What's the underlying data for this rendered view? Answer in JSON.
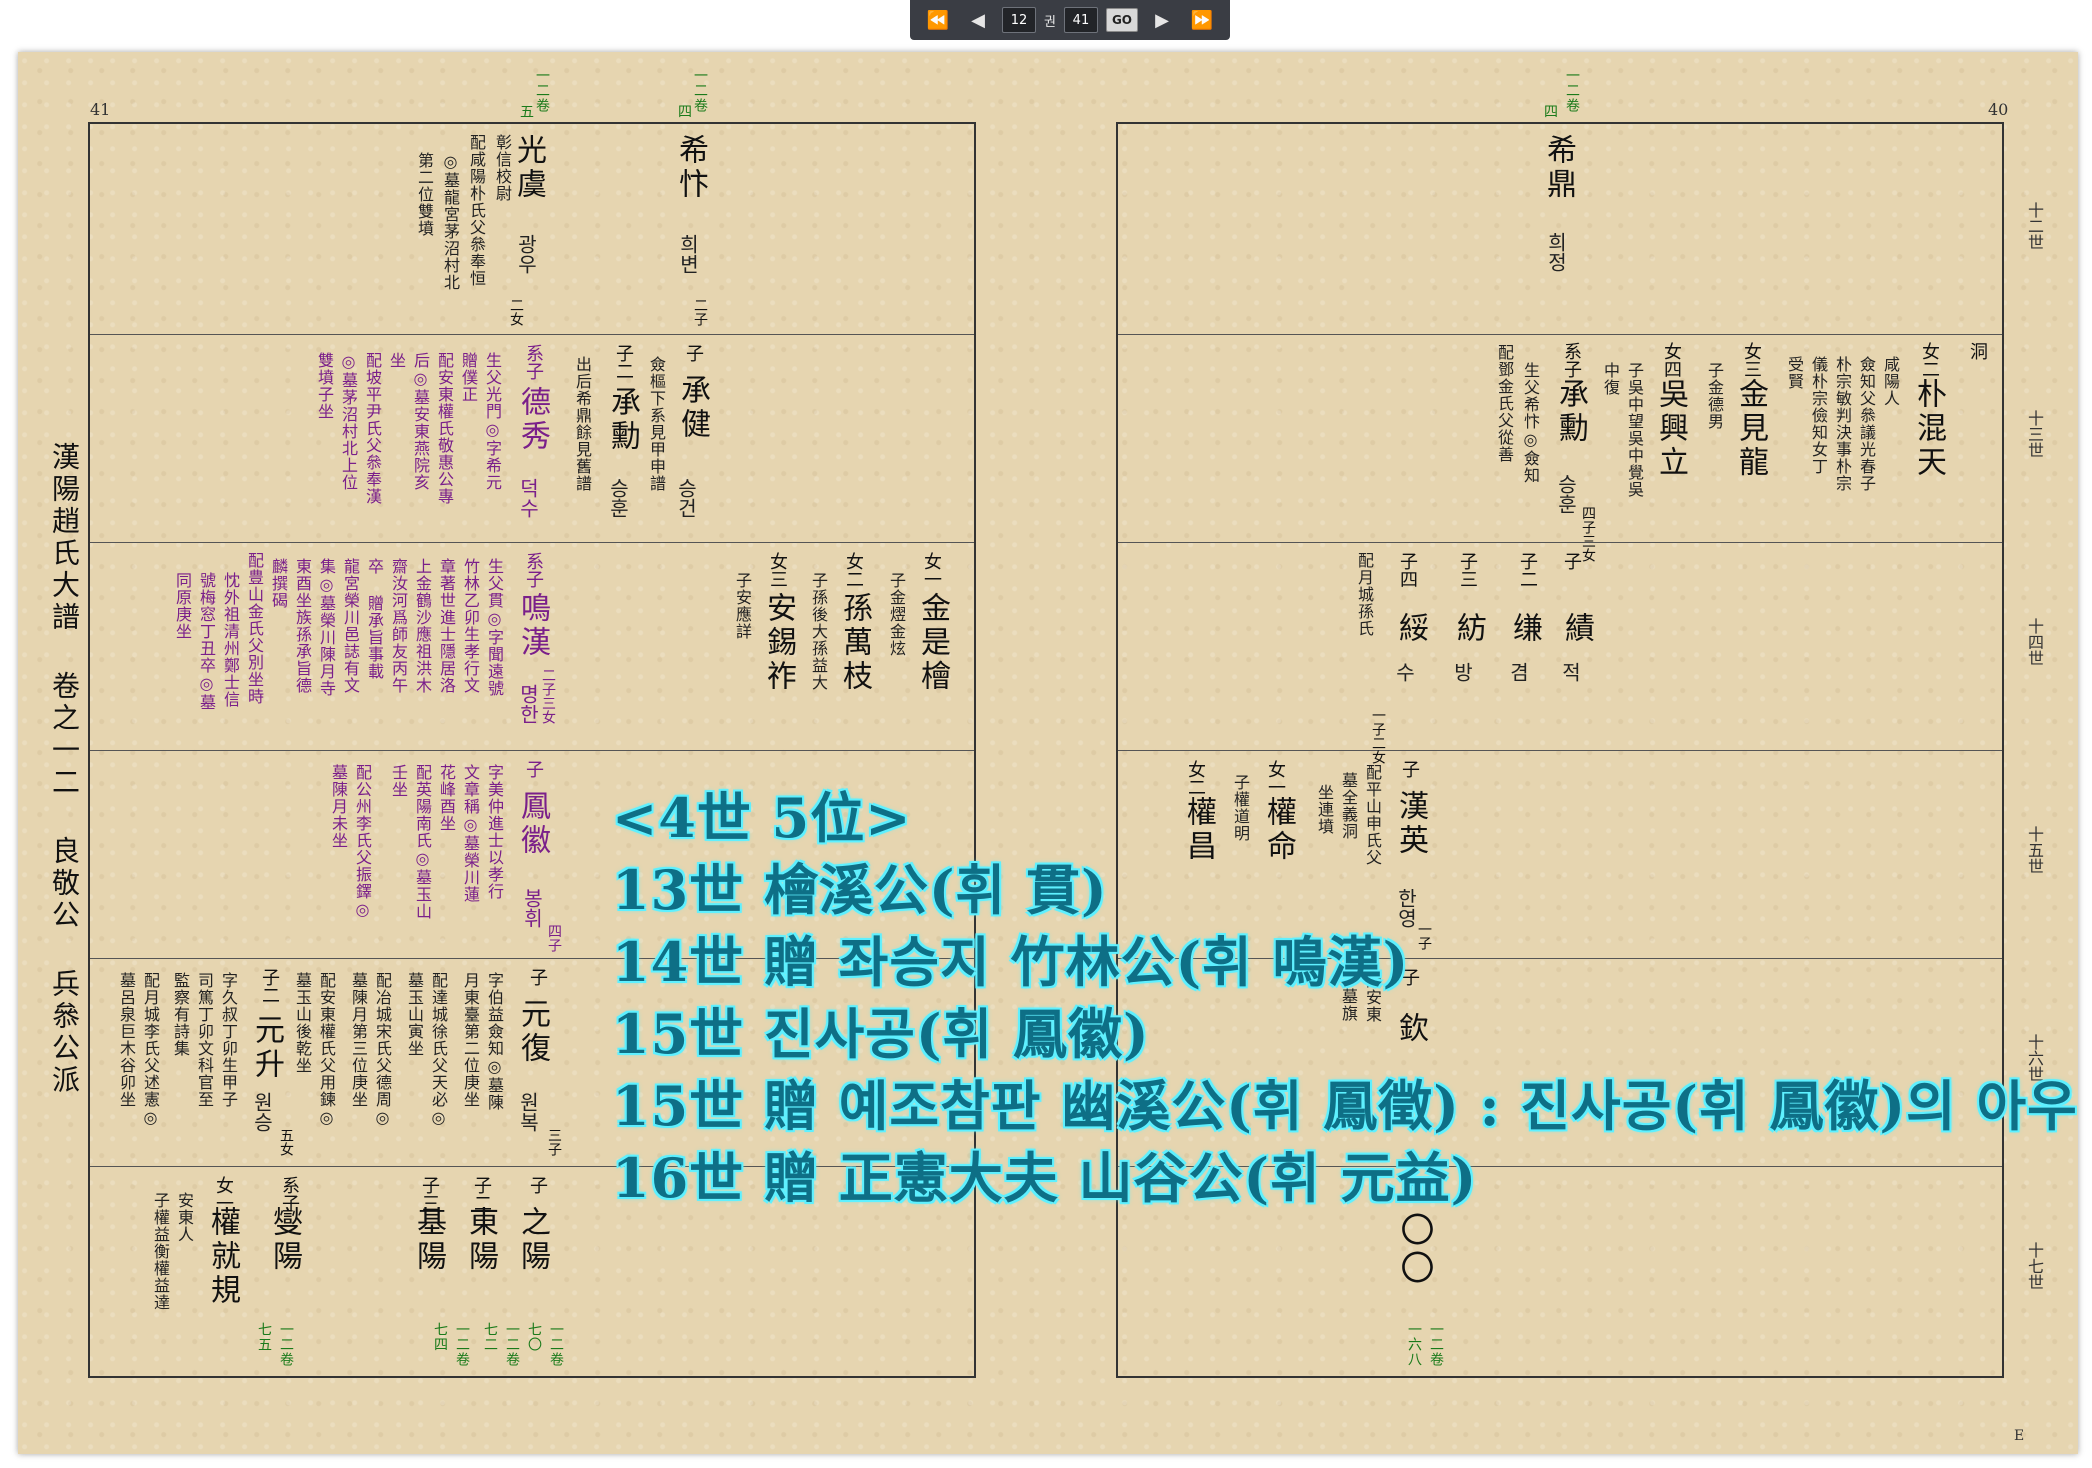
{
  "toolbar": {
    "first_icon": "⏪",
    "prev_icon": "◀",
    "next_icon": "▶",
    "last_icon": "⏩",
    "volume_value": "12",
    "volume_unit": "권",
    "page_value": "41",
    "go_label": "GO"
  },
  "book": {
    "title": "漢陽趙氏大譜 卷之一二 良敬公 兵叅公派",
    "left_page_number": "41",
    "right_page_number": "40",
    "corner_mark": "Ε"
  },
  "generations": [
    "十二世",
    "十三世",
    "十四世",
    "十五世",
    "十六世",
    "十七世"
  ],
  "left_page": {
    "top_tags": [
      {
        "vol": "一二卷",
        "sub": "五"
      },
      {
        "vol": "一二卷",
        "sub": "四"
      }
    ],
    "r1": {
      "a_name": "希忭",
      "a_hangul": "희변",
      "a_count": "二子",
      "b_name": "光虞",
      "b_hangul": "광우",
      "b_count": "二女",
      "b_note": [
        "彰信校尉",
        "配咸陽朴氏父叅奉恒",
        "◎墓龍宮茅沼村北",
        "第二位雙墳"
      ]
    },
    "r2": {
      "c1_rel": "子",
      "c1_name": "承健",
      "c1_hangul": "승건",
      "c1_note": [
        "僉樞下系見甲申譜"
      ],
      "c2_rel": "子二",
      "c2_name": "承勳",
      "c2_hangul": "승훈",
      "c2_note": [
        "出后希鼎餘見舊譜"
      ],
      "c3_rel": "系子",
      "c3_name": "德秀",
      "c3_hangul": "덕수",
      "c3_note": [
        "生父光門◎字希元",
        "贈僕正",
        "配安東權氏敬惠公專",
        "后◎墓安東燕院亥",
        "坐",
        "配坡平尹氏父叅奉漢",
        "◎墓茅沼村北上位",
        "雙墳子坐"
      ]
    },
    "r3": {
      "d1_rel": "女一",
      "d1_name": "金是檜",
      "d1_note": [
        "子金熤金炫"
      ],
      "d2_rel": "女二",
      "d2_name": "孫萬枝",
      "d2_note": [
        "子孫後大孫益大"
      ],
      "d3_rel": "女三",
      "d3_name": "安錫祚",
      "d3_note": [
        "子安應詳"
      ],
      "d4_rel": "系子",
      "d4_name": "鳴漢",
      "d4_hangul": "명한",
      "d4_count": "二子三女",
      "d4_note": [
        "生父貫◎字聞遠號",
        "竹林乙卯生孝行文",
        "章著世進士隱居洛",
        "上金鶴沙應祖洪木",
        "齋汝河爲師友丙午",
        "卒 贈承旨事載",
        "龍宮榮川邑誌有文",
        "集◎墓榮川陳月寺",
        "東酉坐族孫承旨德",
        "麟撰碣",
        "配豊山金氏父別坐時",
        "忱外祖清州鄭士信",
        "號梅窓丁丑卒◎墓",
        "同原庚坐"
      ]
    },
    "r4": {
      "e1_rel": "子",
      "e1_name": "鳳徽",
      "e1_hangul": "봉휘",
      "e1_count": "四子",
      "e1_note": [
        "字美仲進士以孝行",
        "文章稱◎墓榮川蓮",
        "花峰酉坐",
        "配英陽南氏◎墓玉山",
        "壬坐",
        "配公州李氏父振鐸◎",
        "墓陳月未坐"
      ]
    },
    "r5": {
      "f1_rel": "子",
      "f1_name": "元復",
      "f1_hangul": "원복",
      "f1_count": "三子",
      "f1_note": [
        "字伯益僉知◎墓陳",
        "月東臺第二位庚坐",
        "配達城徐氏父天必◎",
        "墓玉山寅坐",
        "配冶城宋氏父德周◎",
        "墓陳月第三位庚坐",
        "配安東權氏父用鍊◎",
        "墓玉山後乾坐"
      ],
      "f2_rel": "子二",
      "f2_name": "元升",
      "f2_hangul": "원승",
      "f2_count": "五女",
      "f2_note": [
        "字久叔丁卯生甲子",
        "司篤丁卯文科官至",
        "監察有詩集",
        "配月城李氏父述憲◎",
        "墓呂泉巨木谷卯坐"
      ]
    },
    "r6": {
      "g1_rel": "子",
      "g1_name": "之陽",
      "g2_rel": "子二",
      "g2_name": "東陽",
      "g3_rel": "子三",
      "g3_name": "基陽",
      "g4_rel": "系子",
      "g4_name": "燮陽",
      "g5_rel": "女一",
      "g5_name": "權就規",
      "g5_note": [
        "安東人",
        "子權益衡權益達"
      ]
    },
    "bottom_tags": [
      {
        "vol": "一二卷",
        "sub": "七〇"
      },
      {
        "vol": "一二卷",
        "sub": "七二"
      },
      {
        "vol": "一二卷",
        "sub": "七四"
      },
      {
        "vol": "一二卷",
        "sub": "七五"
      }
    ]
  },
  "right_page": {
    "top_tag": {
      "vol": "一二卷",
      "sub": "四"
    },
    "r1": {
      "name": "希鼎",
      "hangul": "희정"
    },
    "r2": {
      "h1_rel": "女二",
      "h1_name": "朴混天",
      "h1_note": [
        "咸陽人",
        "僉知父叅議光春子",
        "朴宗敏判決事朴宗",
        "儀朴宗儉知女丁",
        "受賢"
      ],
      "h2_rel": "女三",
      "h2_name": "金見龍",
      "h2_note": [
        "子金德男"
      ],
      "h3_rel": "女四",
      "h3_name": "吳興立",
      "h3_note": [
        "子吳中望吳中覺吳",
        "中復"
      ],
      "h4_rel": "系子",
      "h4_name": "承勳",
      "h4_hangul": "승훈",
      "h4_count": "四子三女",
      "h4_note": [
        "生父希忭◎僉知",
        "配鄧金氏父從善"
      ],
      "h5_word": "洞"
    },
    "r3": {
      "i1_rel": "子",
      "i1_name": "績",
      "i1_hangul": "적",
      "i2_rel": "子二",
      "i2_name": "缣",
      "i2_hangul": "겸",
      "i3_rel": "子三",
      "i3_name": "紡",
      "i3_hangul": "방",
      "i4_rel": "子四",
      "i4_name": "綏",
      "i4_hangul": "수",
      "i5_note": [
        "配月城孫氏"
      ],
      "i6_count": "一子二女"
    },
    "r4": {
      "j1_rel": "子",
      "j1_name": "漢英",
      "j1_hangul": "한영",
      "j1_count": "一子",
      "j1_note": [
        "配平山申氏父",
        "墓全義洞",
        "坐連墳"
      ],
      "j2_rel": "女一",
      "j2_name": "權命",
      "j2_note": [
        "子權道明"
      ],
      "j3_rel": "女二",
      "j3_name": "權昌"
    },
    "r5": {
      "k1_rel": "子",
      "k1_name": "欽",
      "k1_note": [
        "配安東",
        "墓旗"
      ]
    },
    "r6": {
      "l1_rel": "子",
      "l1_name": "〇〇"
    },
    "bottom_tag": {
      "vol": "一二卷",
      "sub": "一六八"
    }
  },
  "overlay": {
    "lines": [
      "<4世 5位>",
      "13世 檜溪公(휘 貫)",
      "14世 贈 좌승지 竹林公(휘 鳴漢)",
      "15世 진사공(휘 鳳徽)",
      "15世 贈 예조참판 幽溪公(휘 鳳徵) : 진사공(휘 鳳徽)의 아우",
      "16世 贈 正憲大夫 山谷公(휘 元益)"
    ]
  }
}
